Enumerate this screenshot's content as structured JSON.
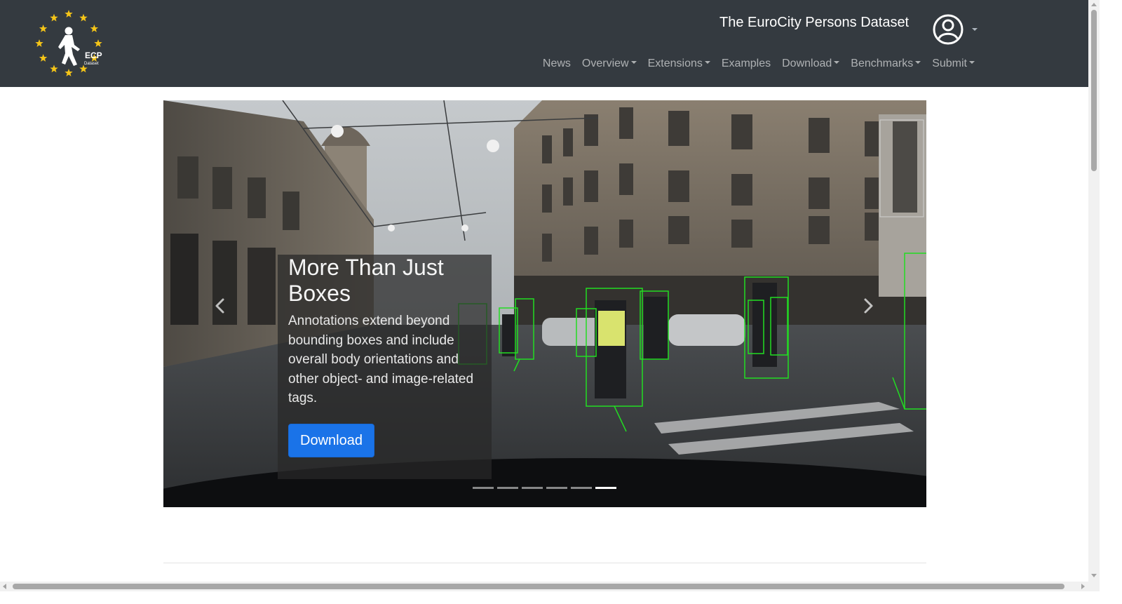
{
  "header": {
    "site_title": "The EuroCity Persons Dataset",
    "logo": {
      "icon": "ecp-logo",
      "text_main": "ECP",
      "text_sub": "Dataset",
      "star_color": "#f5c518"
    },
    "user_menu": {
      "icon": "user-circle-icon"
    }
  },
  "nav": {
    "items": [
      {
        "label": "News",
        "dropdown": false
      },
      {
        "label": "Overview",
        "dropdown": true
      },
      {
        "label": "Extensions",
        "dropdown": true
      },
      {
        "label": "Examples",
        "dropdown": false
      },
      {
        "label": "Download",
        "dropdown": true
      },
      {
        "label": "Benchmarks",
        "dropdown": true
      },
      {
        "label": "Submit",
        "dropdown": true
      }
    ]
  },
  "carousel": {
    "caption": {
      "title": "More Than Just Boxes",
      "text": "Annotations extend beyond bounding boxes and include overall body orientations and other object- and image-related tags.",
      "button_label": "Download"
    },
    "slide_count": 6,
    "active_slide": 6,
    "prev_icon": "chevron-left-icon",
    "next_icon": "chevron-right-icon"
  },
  "colors": {
    "navbar_bg": "#343a40",
    "button_primary": "#1a73e8",
    "annotation_box": "#22dd22"
  }
}
